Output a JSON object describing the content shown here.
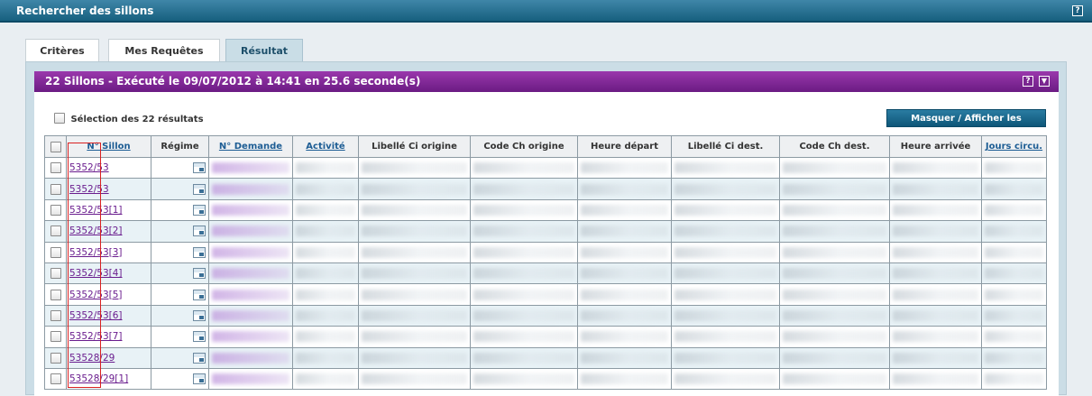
{
  "window": {
    "title": "Rechercher des sillons",
    "help": "?"
  },
  "tabs": [
    {
      "label": "Critères"
    },
    {
      "label": "Mes Requêtes"
    },
    {
      "label": "Résultat"
    }
  ],
  "result_header": {
    "title": "22 Sillons - Exécuté le 09/07/2012 à 14:41 en 25.6 seconde(s)",
    "help": "?",
    "collapse": "▼"
  },
  "select_all_label": "Sélection des 22 résultats",
  "columns_button": "Masquer / Afficher les colonnes",
  "columns": [
    {
      "label": "N° Sillon",
      "sortable": true
    },
    {
      "label": "Régime",
      "sortable": false
    },
    {
      "label": "N° Demande",
      "sortable": true
    },
    {
      "label": "Activité",
      "sortable": true
    },
    {
      "label": "Libellé Ci origine",
      "sortable": false
    },
    {
      "label": "Code Ch origine",
      "sortable": false
    },
    {
      "label": "Heure départ",
      "sortable": false
    },
    {
      "label": "Libellé Ci dest.",
      "sortable": false
    },
    {
      "label": "Code Ch dest.",
      "sortable": false
    },
    {
      "label": "Heure arrivée",
      "sortable": false
    },
    {
      "label": "Jours circu.",
      "sortable": true
    }
  ],
  "rows": [
    {
      "sillon": "5352/53"
    },
    {
      "sillon": "5352/53"
    },
    {
      "sillon": "5352/53[1]"
    },
    {
      "sillon": "5352/53[2]"
    },
    {
      "sillon": "5352/53[3]"
    },
    {
      "sillon": "5352/53[4]"
    },
    {
      "sillon": "5352/53[5]"
    },
    {
      "sillon": "5352/53[6]"
    },
    {
      "sillon": "5352/53[7]"
    },
    {
      "sillon": "53528/29"
    },
    {
      "sillon": "53528/29[1]"
    }
  ],
  "colors": {
    "title_bar": "#17607f",
    "result_bar": "#7a2590",
    "link": "#6a1d8e",
    "highlight": "#d92121"
  }
}
